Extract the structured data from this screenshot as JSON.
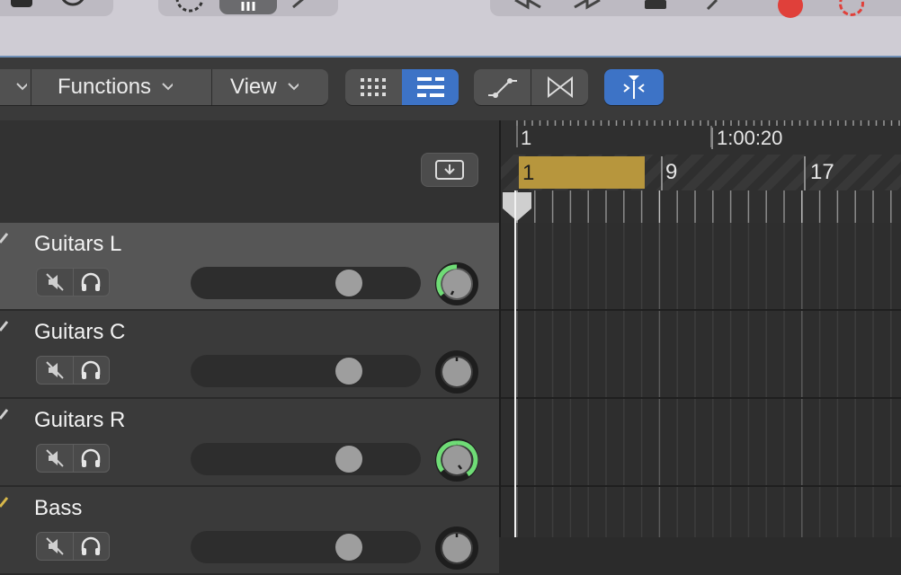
{
  "toolbar": {
    "functions_label": "Functions",
    "view_label": "View"
  },
  "ruler": {
    "bar_label": "1",
    "time_label": "1:00:20",
    "cycle_label": "1",
    "marker_9": "9",
    "marker_17": "17"
  },
  "tracks": [
    {
      "name": "Guitars L",
      "volume": 0.72,
      "selected": true
    },
    {
      "name": "Guitars C",
      "volume": 0.72,
      "selected": false
    },
    {
      "name": "Guitars R",
      "volume": 0.72,
      "selected": false
    },
    {
      "name": "Bass",
      "volume": 0.72,
      "selected": false
    }
  ],
  "colors": {
    "accent_blue": "#3d73c6",
    "cycle_yellow": "#b7963d",
    "pan_green": "#6fdc76"
  }
}
